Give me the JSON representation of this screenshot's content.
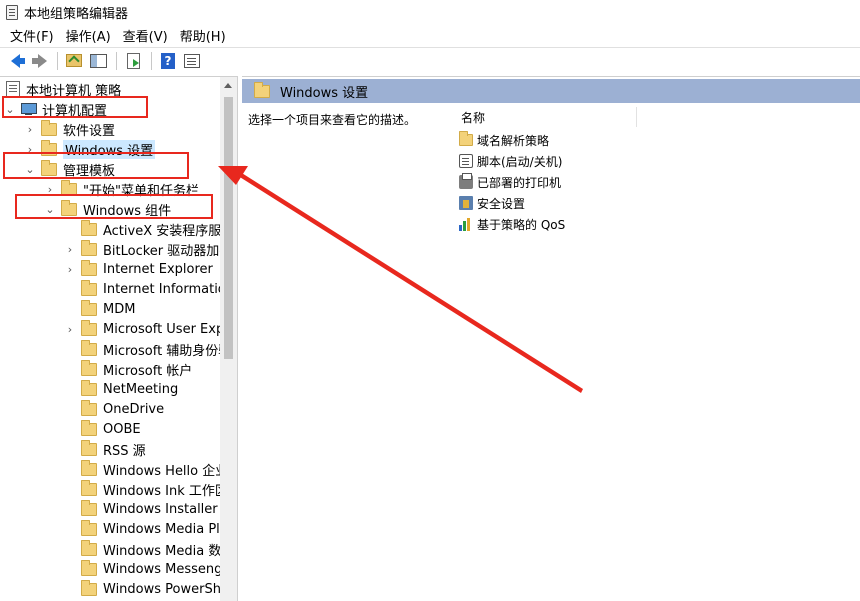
{
  "window": {
    "title": "本地组策略编辑器"
  },
  "menu": {
    "items": [
      "文件(F)",
      "操作(A)",
      "查看(V)",
      "帮助(H)"
    ]
  },
  "toolbar": {
    "icons": [
      "back-icon",
      "forward-icon",
      "up-folder-icon",
      "show-hide-tree-icon",
      "export-list-icon",
      "help-icon",
      "properties-icon"
    ]
  },
  "tree": {
    "root": "本地计算机 策略",
    "computer_config": "计算机配置",
    "software_settings": "软件设置",
    "windows_settings": "Windows 设置",
    "admin_templates": "管理模板",
    "start_menu": "\"开始\"菜单和任务栏",
    "windows_components": "Windows 组件",
    "components": [
      "ActiveX 安装程序服务",
      "BitLocker 驱动器加密",
      "Internet Explorer",
      "Internet Information",
      "MDM",
      "Microsoft User Expe",
      "Microsoft 辅助身份验",
      "Microsoft 帐户",
      "NetMeeting",
      "OneDrive",
      "OOBE",
      "RSS 源",
      "Windows Hello 企业",
      "Windows Ink 工作区",
      "Windows Installer",
      "Windows Media Play",
      "Windows Media 数字",
      "Windows Messenge",
      "Windows PowerShel"
    ]
  },
  "right": {
    "header_title": "Windows 设置",
    "description": "选择一个项目来查看它的描述。",
    "column_name": "名称",
    "items": [
      {
        "label": "域名解析策略",
        "icon": "folder-icon"
      },
      {
        "label": "脚本(启动/关机)",
        "icon": "script-icon"
      },
      {
        "label": "已部署的打印机",
        "icon": "printer-icon"
      },
      {
        "label": "安全设置",
        "icon": "security-icon"
      },
      {
        "label": "基于策略的 QoS",
        "icon": "qos-chart-icon"
      }
    ]
  },
  "annotation": {
    "color": "#e8281e"
  }
}
